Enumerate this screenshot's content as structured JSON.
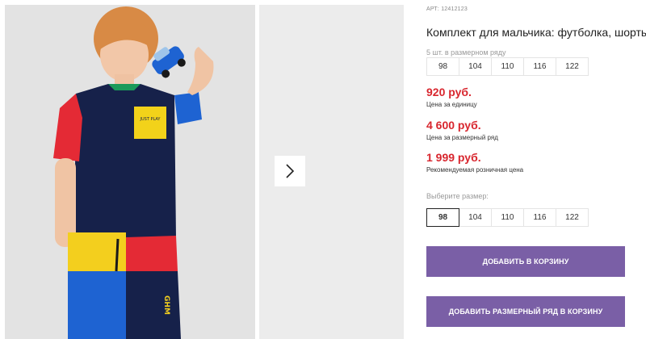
{
  "product": {
    "sku_label": "АРТ:",
    "sku": "12412123",
    "title": "Комплект для мальчика: футболка, шорты"
  },
  "pack": {
    "caption": "5 шт. в размерном ряду",
    "sizes": [
      "98",
      "104",
      "110",
      "116",
      "122"
    ]
  },
  "prices": [
    {
      "value": "920 руб.",
      "note": "Цена за единицу"
    },
    {
      "value": "4 600 руб.",
      "note": "Цена за размерный ряд"
    },
    {
      "value": "1 999 руб.",
      "note": "Рекомендуемая розничная цена"
    }
  ],
  "size_select": {
    "caption": "Выберите размер:",
    "sizes": [
      "98",
      "104",
      "110",
      "116",
      "122"
    ],
    "selected": "98"
  },
  "buttons": {
    "add_to_cart": "ДОБАВИТЬ В КОРЗИНУ",
    "add_pack_to_cart": "ДОБАВИТЬ РАЗМЕРНЫЙ РЯД В КОРЗИНУ"
  },
  "gallery": {
    "shirt_print": "JUST PLAY",
    "shorts_print": "GHM",
    "next_icon": "chevron-right-icon"
  },
  "colors": {
    "price": "#d8262e",
    "button": "#7a5fa6",
    "shirt_navy": "#16214a",
    "sleeve_red": "#e42a35",
    "sleeve_blue": "#1e63d2",
    "shorts_yellow": "#f3cf1e",
    "pocket_yellow": "#f2d21a"
  }
}
